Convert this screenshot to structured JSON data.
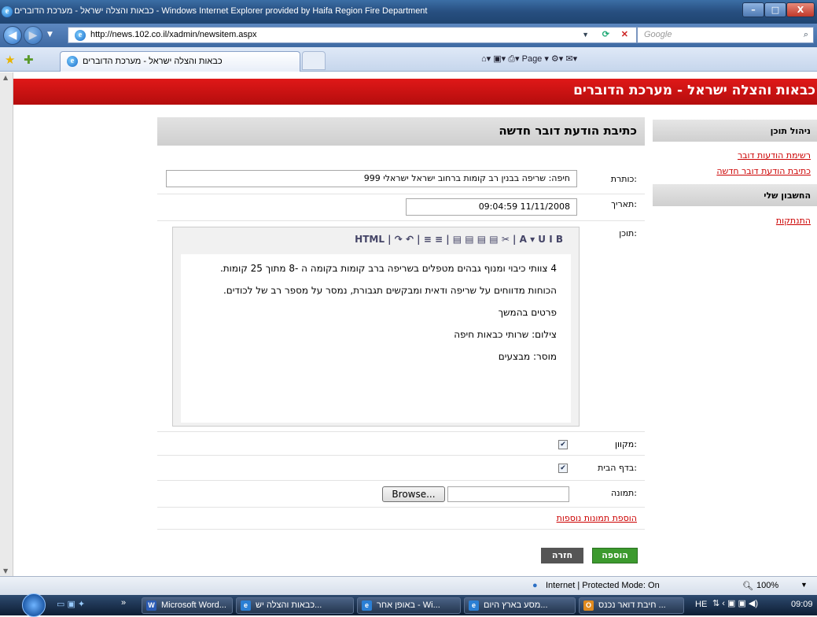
{
  "window": {
    "title": "כבאות והצלה ישראל - מערכת הדוברים - Windows Internet Explorer provided by Haifa Region Fire Department",
    "min": "–",
    "max": "□",
    "close": "X"
  },
  "address": {
    "url": "http://news.102.co.il/xadmin/newsitem.aspx",
    "search_placeholder": "Google"
  },
  "tabs": {
    "active_label": "כבאות והצלה ישראל - מערכת הדוברים",
    "command_bar": "Page ▾  ⚙▾  ✉▾"
  },
  "banner": {
    "title": "כבאות והצלה ישראל - מערכת הדוברים"
  },
  "sidebar": {
    "content_head": "ניהול תוכן",
    "links": [
      "רשימת הודעות דובר",
      "כתיבת הודעת דובר חדשה"
    ],
    "account_head": "החשבון שלי",
    "logout": "התנתקות"
  },
  "form": {
    "heading": "כתיבת הודעת דובר חדשה",
    "title_label": "כותרת:",
    "title_value": "חיפה: שריפה בבנין רב קומות ברחוב ישראל ישראלי 999",
    "date_label": "תאריך:",
    "date_value": "09:04:59 11/11/2008",
    "content_label": "תוכן:",
    "toolbar": "HTML | ↷ ↶ | ≡ ≡ | ▤ ▤ ▤ ▤ ✂ | A ▾ U I B",
    "body": [
      "4 צוותי כיבוי ומנוף גבהים מטפלים בשריפה ברב קומות בקומה ה -8 מתוך 25 קומות.",
      "הכוחות מדווחים על שריפה ודאית ומבקשים תגבורת, נמסר על מספר רב של לכודים.",
      "פרטים בהמשך",
      "צילום: שרותי כבאות חיפה",
      "מוסר: מבצעים"
    ],
    "online_label": "מקוון:",
    "home_label": "בדף הבית:",
    "image_label": "תמונה:",
    "browse": "Browse...",
    "more_images": "הוספת תמונות נוספות",
    "add_btn": "הוספה",
    "back_btn": "חזרה",
    "online_checked": true,
    "home_checked": true
  },
  "status": {
    "zone": "Internet | Protected Mode: On",
    "zoom": "100%"
  },
  "taskbar": {
    "items": [
      "Microsoft Word...",
      "כבאות והצלה יש...",
      "באופן אחר - Wi...",
      "מסע בארץ היום...",
      "חיבת דואר נכנס ..."
    ],
    "lang": "HE",
    "clock": "09:09"
  },
  "colors": {
    "banner": "#d01010",
    "link": "#cc0000",
    "add_btn": "#3c9a2e",
    "back_btn": "#555555"
  }
}
